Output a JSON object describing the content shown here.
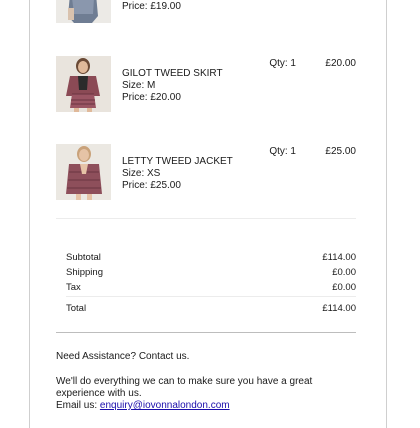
{
  "items": [
    {
      "name": "",
      "size": "",
      "price": "Price: £19.00",
      "qty": "",
      "line_total": ""
    },
    {
      "name": "GILOT TWEED SKIRT",
      "size": "Size: M",
      "price": "Price: £20.00",
      "qty": "Qty: 1",
      "line_total": "£20.00"
    },
    {
      "name": "LETTY TWEED JACKET",
      "size": "Size: XS",
      "price": "Price: £25.00",
      "qty": "Qty: 1",
      "line_total": "£25.00"
    }
  ],
  "totals": {
    "subtotal_label": "Subtotal",
    "subtotal_value": "£114.00",
    "shipping_label": "Shipping",
    "shipping_value": "£0.00",
    "tax_label": "Tax",
    "tax_value": "£0.00",
    "total_label": "Total",
    "total_value": "£114.00"
  },
  "assistance": {
    "heading": "Need Assistance? Contact us.",
    "body": "We'll do everything we can to make sure you have a great experience with us.",
    "email_label": "Email us:",
    "email": "enquiry@iovonnalondon.com"
  },
  "colors": {
    "link": "#1a0dab",
    "divider": "#bdbdbd"
  }
}
